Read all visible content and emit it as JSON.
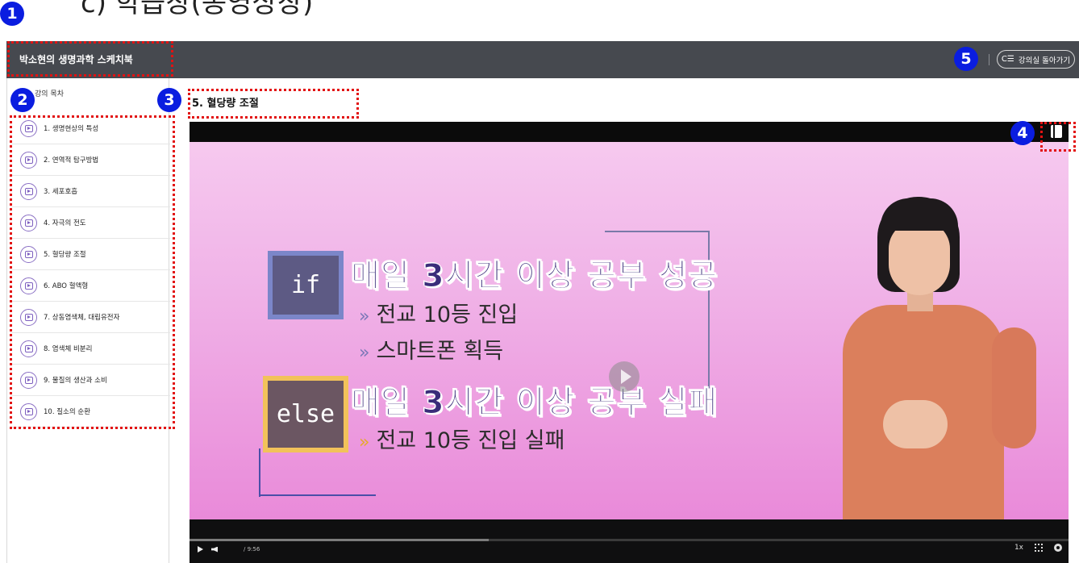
{
  "page": {
    "heading": "c) 학습창(동영상창)"
  },
  "annotations": {
    "n1": "1",
    "n2": "2",
    "n3": "3",
    "n4": "4",
    "n5": "5",
    "color": "#0a1de0",
    "dash_color": "#e21212"
  },
  "header": {
    "title": "박소현의 생명과학 스케치북",
    "back_button_icon": "list-back-icon",
    "back_button_glyph": "C☰",
    "back_button_label": "강의실 돌아가기"
  },
  "sidebar": {
    "header_label": "강의 목차",
    "items": [
      {
        "label": "1. 생명현상의 특성",
        "icon": "play-icon"
      },
      {
        "label": "2. 연역적 탐구방법",
        "icon": "play-icon"
      },
      {
        "label": "3. 세포호흡",
        "icon": "play-icon"
      },
      {
        "label": "4. 자극의 전도",
        "icon": "play-icon"
      },
      {
        "label": "5. 혈당량 조절",
        "icon": "play-icon"
      },
      {
        "label": "6. ABO 혈액형",
        "icon": "play-icon"
      },
      {
        "label": "7. 상동염색체, 대립유전자",
        "icon": "play-icon"
      },
      {
        "label": "8. 염색체 비분리",
        "icon": "play-icon"
      },
      {
        "label": "9. 물질의 생산과 소비",
        "icon": "play-icon"
      },
      {
        "label": "10. 질소의 순환",
        "icon": "play-icon"
      }
    ]
  },
  "content": {
    "title": "5. 혈당량 조절"
  },
  "video": {
    "if_label": "if",
    "if_line": "매일 3시간 이상 공부 성공",
    "if_sub1": "전교 10등 진입",
    "if_sub2": "스마트폰 획득",
    "else_label": "else",
    "else_line": "매일 3시간 이상 공부 실패",
    "else_sub1": "전교 10등 진입 실패",
    "arrow": "»",
    "background": "#f0b2e7"
  },
  "controls": {
    "time": "/ 9:56",
    "speed": "1x",
    "progress_fraction": 0.34
  }
}
